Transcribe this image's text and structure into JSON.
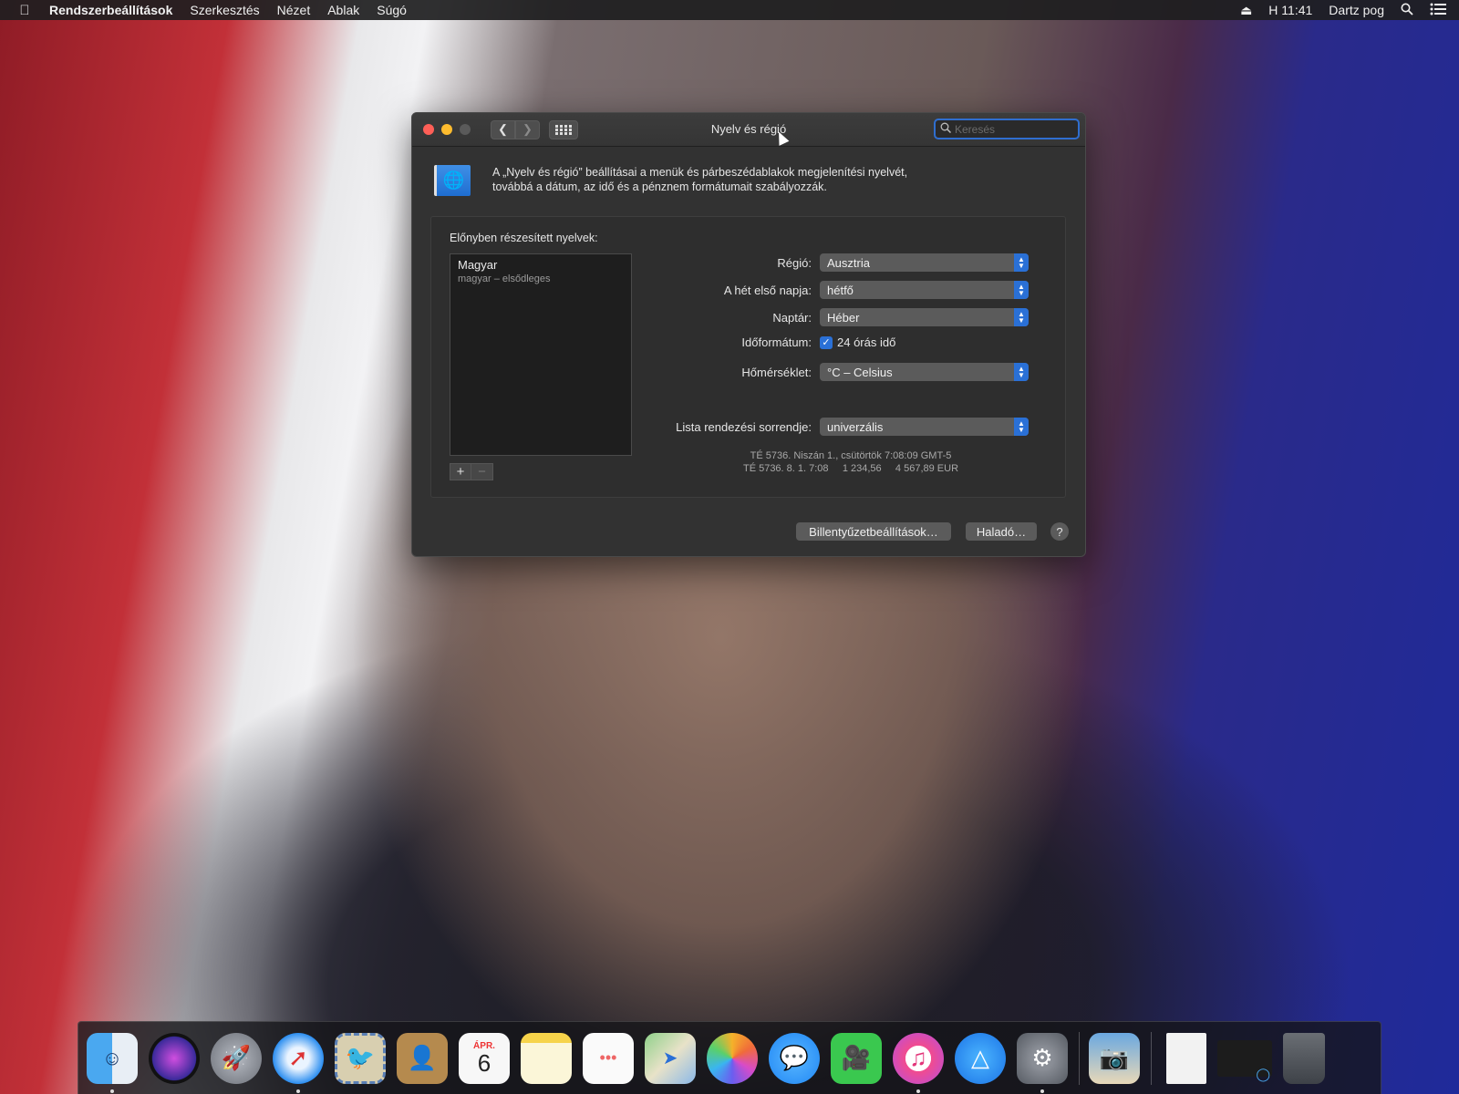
{
  "menubar": {
    "apple": "",
    "app_name": "Rendszerbeállítások",
    "items": [
      "Szerkesztés",
      "Nézet",
      "Ablak",
      "Súgó"
    ],
    "eject": "⏏",
    "clock": "H 11:41",
    "user": "Dartz pog"
  },
  "window": {
    "title": "Nyelv és régió",
    "search_placeholder": "Keresés",
    "intro_line1": "A „Nyelv és régió” beállításai a menük és párbeszédablakok megjelenítési nyelvét,",
    "intro_line2": "továbbá a dátum, az idő és a pénznem formátumait szabályozzák.",
    "preferred_languages_label": "Előnyben részesített nyelvek:",
    "languages": [
      {
        "name": "Magyar",
        "sub": "magyar – elsődleges"
      }
    ],
    "add_symbol": "+",
    "remove_symbol": "−",
    "fields": {
      "region_label": "Régió:",
      "region_value": "Ausztria",
      "first_day_label": "A hét első napja:",
      "first_day_value": "hétfő",
      "calendar_label": "Naptár:",
      "calendar_value": "Héber",
      "time_format_label": "Időformátum:",
      "time_format_value": "24 órás idő",
      "time_format_checked": true,
      "temperature_label": "Hőmérséklet:",
      "temperature_value": "°C – Celsius",
      "sort_order_label": "Lista rendezési sorrendje:",
      "sort_order_value": "univerzális"
    },
    "sample_line1": "TÉ 5736. Niszán 1., csütörtök 7:08:09 GMT-5",
    "sample_line2": "TÉ 5736. 8. 1. 7:08     1 234,56     4 567,89 EUR",
    "keyboard_button": "Billentyűzetbeállítások…",
    "advanced_button": "Haladó…",
    "help_button": "?"
  },
  "dock": {
    "calendar_month": "ÁPR.",
    "calendar_day": "6",
    "items": [
      "finder-icon",
      "siri-icon",
      "launchpad-icon",
      "safari-icon",
      "mail-icon",
      "contacts-icon",
      "calendar-icon",
      "notes-icon",
      "reminders-icon",
      "maps-icon",
      "photos-icon",
      "messages-icon",
      "facetime-icon",
      "itunes-icon",
      "app-store-icon",
      "system-preferences-icon",
      "preview-icon",
      "document-icon",
      "downloads-icon",
      "trash-icon"
    ]
  }
}
